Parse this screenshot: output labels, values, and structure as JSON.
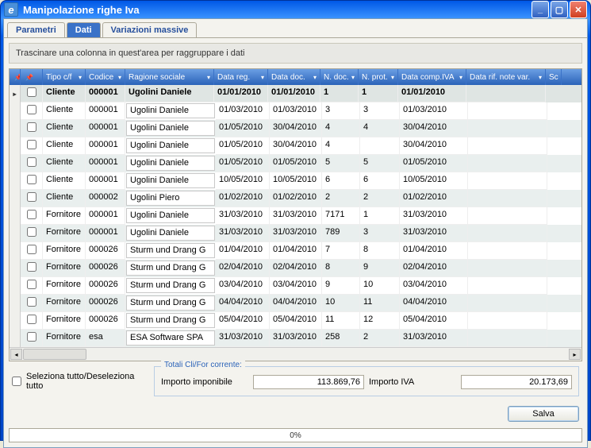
{
  "window": {
    "title": "Manipolazione righe Iva",
    "app_icon_letter": "e"
  },
  "tabs": [
    {
      "label": "Parametri",
      "active": false
    },
    {
      "label": "Dati",
      "active": true
    },
    {
      "label": "Variazioni massive",
      "active": false
    }
  ],
  "group_hint": "Trascinare una colonna in quest'area per raggruppare i dati",
  "columns": {
    "ind": "",
    "chk": "",
    "tipo": "Tipo c/f",
    "cod": "Codice",
    "rag": "Ragione sociale",
    "dr": "Data reg.",
    "dd": "Data doc.",
    "nd": "N. doc.",
    "np": "N. prot.",
    "dc": "Data comp.IVA",
    "drn": "Data rif. note var.",
    "sc": "Sc"
  },
  "rows": [
    {
      "hl": true,
      "tipo": "Cliente",
      "cod": "000001",
      "rag": "Ugolini Daniele",
      "dr": "01/01/2010",
      "dd": "01/01/2010",
      "nd": "1",
      "np": "1",
      "dc": "01/01/2010",
      "drn": ""
    },
    {
      "hl": false,
      "tipo": "Cliente",
      "cod": "000001",
      "rag": "Ugolini Daniele",
      "dr": "01/03/2010",
      "dd": "01/03/2010",
      "nd": "3",
      "np": "3",
      "dc": "01/03/2010",
      "drn": ""
    },
    {
      "hl": false,
      "tipo": "Cliente",
      "cod": "000001",
      "rag": "Ugolini Daniele",
      "dr": "01/05/2010",
      "dd": "30/04/2010",
      "nd": "4",
      "np": "4",
      "dc": "30/04/2010",
      "drn": ""
    },
    {
      "hl": false,
      "tipo": "Cliente",
      "cod": "000001",
      "rag": "Ugolini Daniele",
      "dr": "01/05/2010",
      "dd": "30/04/2010",
      "nd": "4",
      "np": "",
      "dc": "30/04/2010",
      "drn": ""
    },
    {
      "hl": false,
      "tipo": "Cliente",
      "cod": "000001",
      "rag": "Ugolini Daniele",
      "dr": "01/05/2010",
      "dd": "01/05/2010",
      "nd": "5",
      "np": "5",
      "dc": "01/05/2010",
      "drn": ""
    },
    {
      "hl": false,
      "tipo": "Cliente",
      "cod": "000001",
      "rag": "Ugolini Daniele",
      "dr": "10/05/2010",
      "dd": "10/05/2010",
      "nd": "6",
      "np": "6",
      "dc": "10/05/2010",
      "drn": ""
    },
    {
      "hl": false,
      "tipo": "Cliente",
      "cod": "000002",
      "rag": "Ugolini Piero",
      "dr": "01/02/2010",
      "dd": "01/02/2010",
      "nd": "2",
      "np": "2",
      "dc": "01/02/2010",
      "drn": ""
    },
    {
      "hl": false,
      "tipo": "Fornitore",
      "cod": "000001",
      "rag": "Ugolini Daniele",
      "dr": "31/03/2010",
      "dd": "31/03/2010",
      "nd": "7171",
      "np": "1",
      "dc": "31/03/2010",
      "drn": ""
    },
    {
      "hl": false,
      "tipo": "Fornitore",
      "cod": "000001",
      "rag": "Ugolini Daniele",
      "dr": "31/03/2010",
      "dd": "31/03/2010",
      "nd": "789",
      "np": "3",
      "dc": "31/03/2010",
      "drn": ""
    },
    {
      "hl": false,
      "tipo": "Fornitore",
      "cod": "000026",
      "rag": "Sturm und Drang G",
      "dr": "01/04/2010",
      "dd": "01/04/2010",
      "nd": "7",
      "np": "8",
      "dc": "01/04/2010",
      "drn": ""
    },
    {
      "hl": false,
      "tipo": "Fornitore",
      "cod": "000026",
      "rag": "Sturm und Drang G",
      "dr": "02/04/2010",
      "dd": "02/04/2010",
      "nd": "8",
      "np": "9",
      "dc": "02/04/2010",
      "drn": ""
    },
    {
      "hl": false,
      "tipo": "Fornitore",
      "cod": "000026",
      "rag": "Sturm und Drang G",
      "dr": "03/04/2010",
      "dd": "03/04/2010",
      "nd": "9",
      "np": "10",
      "dc": "03/04/2010",
      "drn": ""
    },
    {
      "hl": false,
      "tipo": "Fornitore",
      "cod": "000026",
      "rag": "Sturm und Drang G",
      "dr": "04/04/2010",
      "dd": "04/04/2010",
      "nd": "10",
      "np": "11",
      "dc": "04/04/2010",
      "drn": ""
    },
    {
      "hl": false,
      "tipo": "Fornitore",
      "cod": "000026",
      "rag": "Sturm und Drang G",
      "dr": "05/04/2010",
      "dd": "05/04/2010",
      "nd": "11",
      "np": "12",
      "dc": "05/04/2010",
      "drn": ""
    },
    {
      "hl": false,
      "tipo": "Fornitore",
      "cod": "esa",
      "rag": "ESA Software SPA",
      "dr": "31/03/2010",
      "dd": "31/03/2010",
      "nd": "258",
      "np": "2",
      "dc": "31/03/2010",
      "drn": ""
    }
  ],
  "footer": {
    "select_all_label": "Seleziona tutto/Deseleziona tutto",
    "totals_legend": "Totali Cli/For corrente:",
    "imponibile_label": "Importo imponibile",
    "imponibile_value": "113.869,76",
    "iva_label": "Importo IVA",
    "iva_value": "20.173,69",
    "save_label": "Salva",
    "progress_text": "0%"
  }
}
